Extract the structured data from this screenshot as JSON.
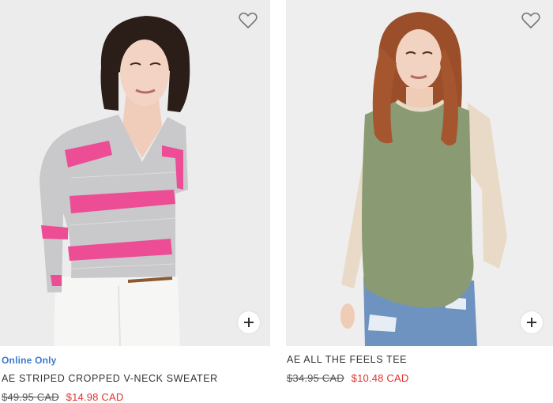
{
  "products": [
    {
      "flag": "Online Only",
      "name": "AE STRIPED CROPPED V-NECK SWEATER",
      "original_price": "$49.95 CAD",
      "sale_price": "$14.98 CAD",
      "image": "model in grey and pink striped cropped v-neck sweater with white jeans"
    },
    {
      "flag": "",
      "name": "AE ALL THE FEELS TEE",
      "original_price": "$34.95 CAD",
      "sale_price": "$10.48 CAD",
      "image": "model in olive green raglan tee with cream sleeves and ripped jeans"
    }
  ],
  "icons": {
    "wishlist": "heart-icon",
    "quick_add": "plus-icon"
  },
  "colors": {
    "sale": "#e0332d",
    "flag": "#3a7ad0",
    "photo_bg": "#ececec"
  }
}
